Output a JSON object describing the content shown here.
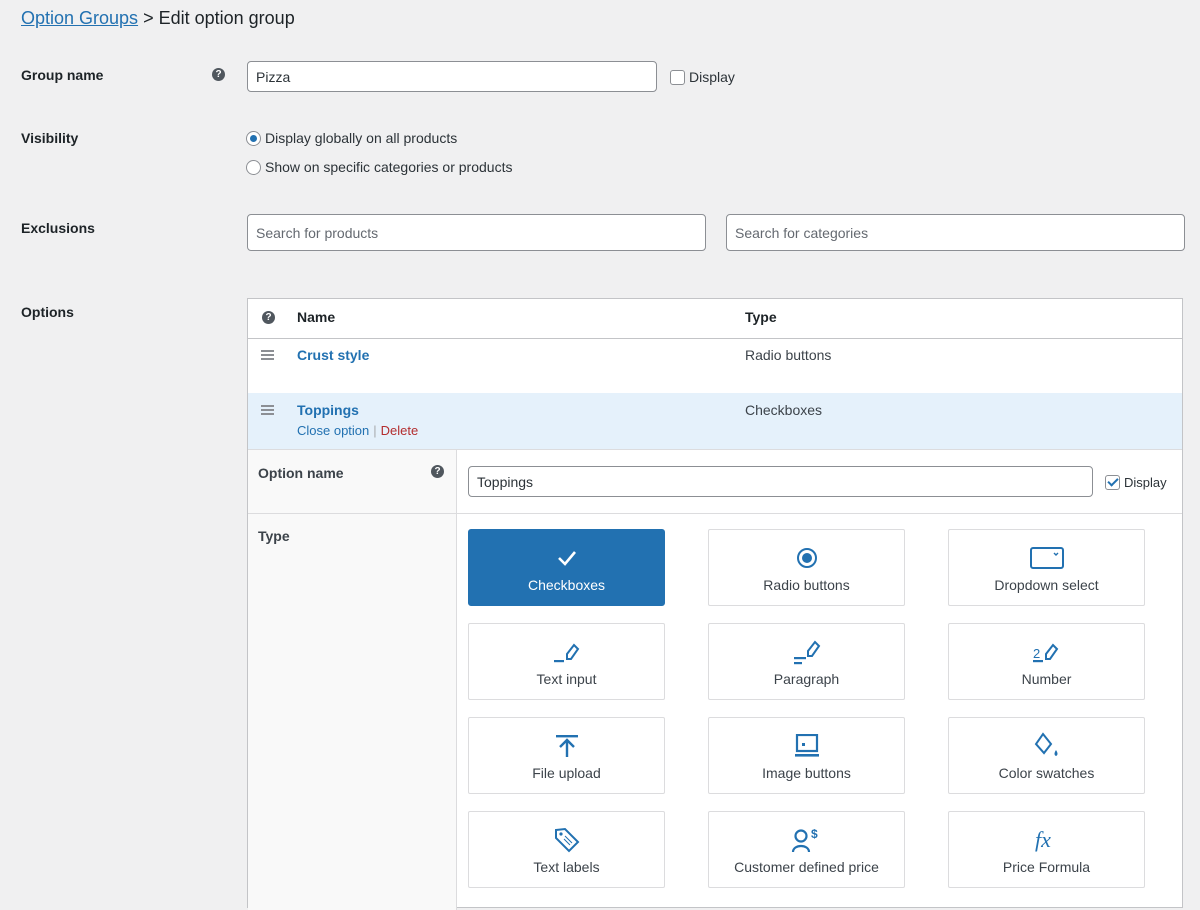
{
  "breadcrumb": {
    "parent_link": "Option Groups",
    "separator": ">",
    "current": "Edit option group"
  },
  "group_name": {
    "label": "Group name",
    "help_icon": "question-circle-icon",
    "value": "Pizza",
    "display_label": "Display",
    "display_checked": false
  },
  "visibility": {
    "label": "Visibility",
    "options": [
      {
        "label": "Display globally on all products",
        "selected": true
      },
      {
        "label": "Show on specific categories or products",
        "selected": false
      }
    ]
  },
  "exclusions": {
    "label": "Exclusions",
    "products_placeholder": "Search for products",
    "categories_placeholder": "Search for categories"
  },
  "options": {
    "label": "Options",
    "columns": {
      "help_icon": "question-circle-icon",
      "name": "Name",
      "type": "Type"
    },
    "rows": [
      {
        "name": "Crust style",
        "type": "Radio buttons",
        "expanded": false
      },
      {
        "name": "Toppings",
        "type": "Checkboxes",
        "expanded": true,
        "actions": {
          "close": "Close option",
          "separator": "|",
          "delete": "Delete"
        }
      }
    ],
    "editor": {
      "option_name_label": "Option name",
      "option_name_value": "Toppings",
      "display_label": "Display",
      "display_checked": true,
      "type_label": "Type",
      "selected_type": "Checkboxes",
      "types": [
        {
          "label": "Checkboxes",
          "icon": "checkmark-icon"
        },
        {
          "label": "Radio buttons",
          "icon": "radio-icon"
        },
        {
          "label": "Dropdown select",
          "icon": "dropdown-icon"
        },
        {
          "label": "Text input",
          "icon": "text-input-icon"
        },
        {
          "label": "Paragraph",
          "icon": "paragraph-icon"
        },
        {
          "label": "Number",
          "icon": "number-icon",
          "icon_text": "2"
        },
        {
          "label": "File upload",
          "icon": "upload-icon"
        },
        {
          "label": "Image buttons",
          "icon": "image-icon"
        },
        {
          "label": "Color swatches",
          "icon": "paint-bucket-icon"
        },
        {
          "label": "Text labels",
          "icon": "tag-icon"
        },
        {
          "label": "Customer defined price",
          "icon": "user-dollar-icon",
          "icon_text": "$"
        },
        {
          "label": "Price Formula",
          "icon": "formula-icon",
          "icon_text": "fx"
        }
      ]
    }
  },
  "colors": {
    "accent": "#2271b1",
    "delete": "#b32d2e",
    "row_highlight": "#e5f1fb",
    "background": "#f0f0f1"
  }
}
